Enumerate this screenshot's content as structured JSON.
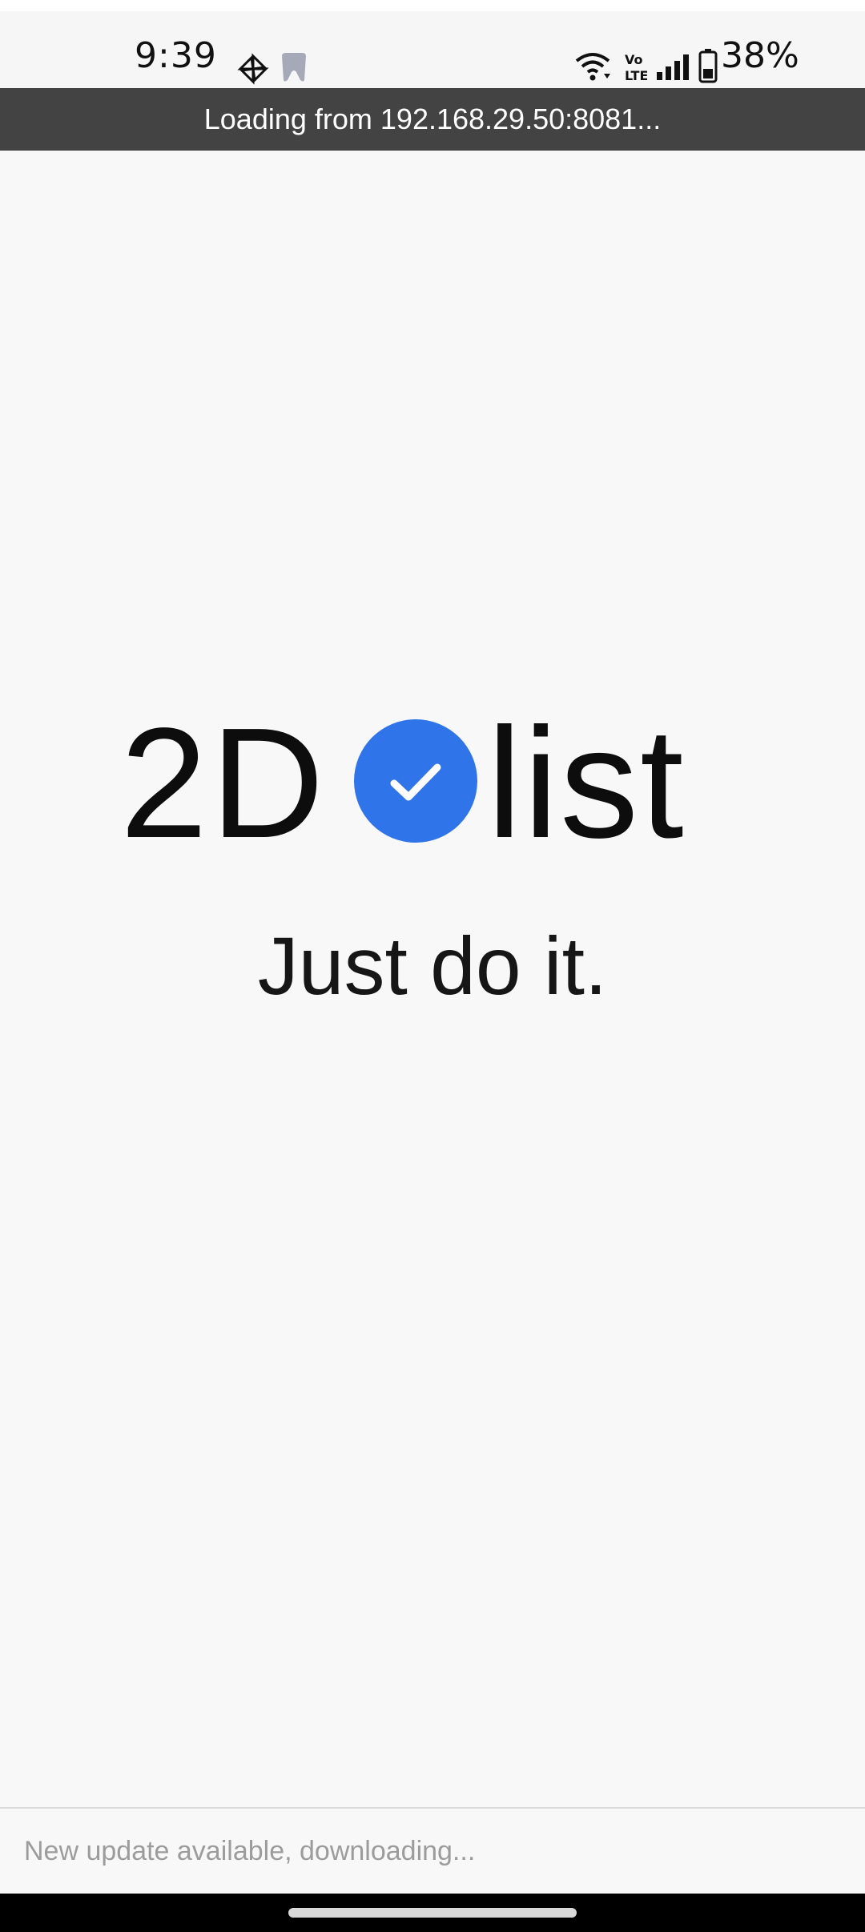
{
  "status_bar": {
    "time": "9:39",
    "battery": "38%",
    "icons": [
      "pinwheel-icon",
      "tooth-icon",
      "wifi-icon",
      "volte-icon",
      "signal-icon",
      "battery-icon"
    ]
  },
  "loading": {
    "text": "Loading from 192.168.29.50:8081..."
  },
  "splash": {
    "logo_left": "2D",
    "logo_right": "list",
    "logo_accent_color": "#2f74e8",
    "tagline": "Just do it."
  },
  "update": {
    "text": "New update available, downloading..."
  }
}
